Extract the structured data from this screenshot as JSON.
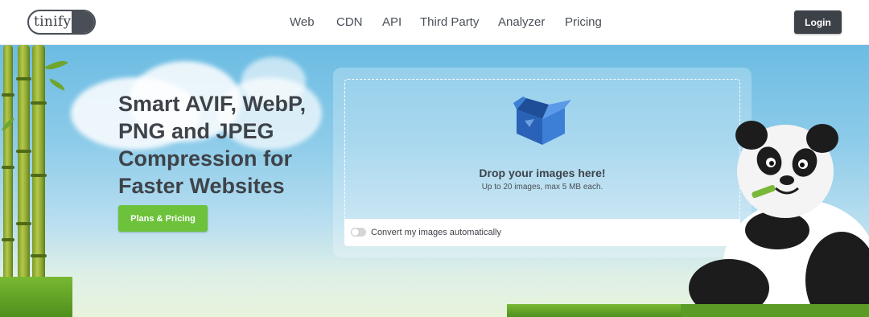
{
  "header": {
    "logo_text": "tinify",
    "nav": [
      {
        "label": "Web"
      },
      {
        "label": "CDN"
      },
      {
        "label": "API"
      },
      {
        "label": "Third Party"
      },
      {
        "label": "Analyzer"
      },
      {
        "label": "Pricing"
      }
    ],
    "login_label": "Login"
  },
  "hero": {
    "headline_lines": [
      "Smart AVIF, WebP,",
      "PNG and JPEG",
      "Compression for",
      "Faster Websites"
    ],
    "cta_label": "Plans & Pricing"
  },
  "dropzone": {
    "title": "Drop your images here!",
    "subtitle": "Up to 20 images, max 5 MB each.",
    "toggle_label": "Convert my images automatically",
    "toggle_on": false
  },
  "colors": {
    "accent_green": "#6cc23a",
    "dark": "#3d4148",
    "box_blue": "#2f6fc7"
  }
}
